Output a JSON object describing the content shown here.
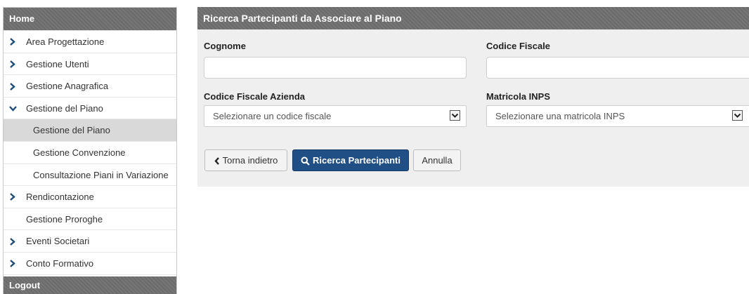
{
  "sidebar": {
    "header": "Home",
    "items": [
      {
        "label": "Area Progettazione"
      },
      {
        "label": "Gestione Utenti"
      },
      {
        "label": "Gestione Anagrafica"
      },
      {
        "label": "Gestione del Piano"
      },
      {
        "label": "Gestione del Piano"
      },
      {
        "label": "Gestione Convenzione"
      },
      {
        "label": "Consultazione Piani in Variazione"
      },
      {
        "label": "Rendicontazione"
      },
      {
        "label": "Gestione Proroghe"
      },
      {
        "label": "Eventi Societari"
      },
      {
        "label": "Conto Formativo"
      }
    ],
    "logout": "Logout"
  },
  "panel": {
    "title": "Ricerca Partecipanti da Associare al Piano",
    "cognome_label": "Cognome",
    "cognome_value": "",
    "codice_fiscale_label": "Codice Fiscale",
    "codice_fiscale_value": "",
    "cf_azienda_label": "Codice Fiscale Azienda",
    "cf_azienda_selected": "Selezionare un codice fiscale",
    "matricola_label": "Matricola INPS",
    "matricola_selected": "Selezionare una matricola INPS",
    "back_button": "Torna indietro",
    "search_button": "Ricerca Partecipanti",
    "cancel_button": "Annulla"
  },
  "colors": {
    "header_gray": "#6f6f6f",
    "primary_blue": "#1f4f85",
    "panel_bg": "#efefef",
    "active_item": "#d9d9d9"
  }
}
